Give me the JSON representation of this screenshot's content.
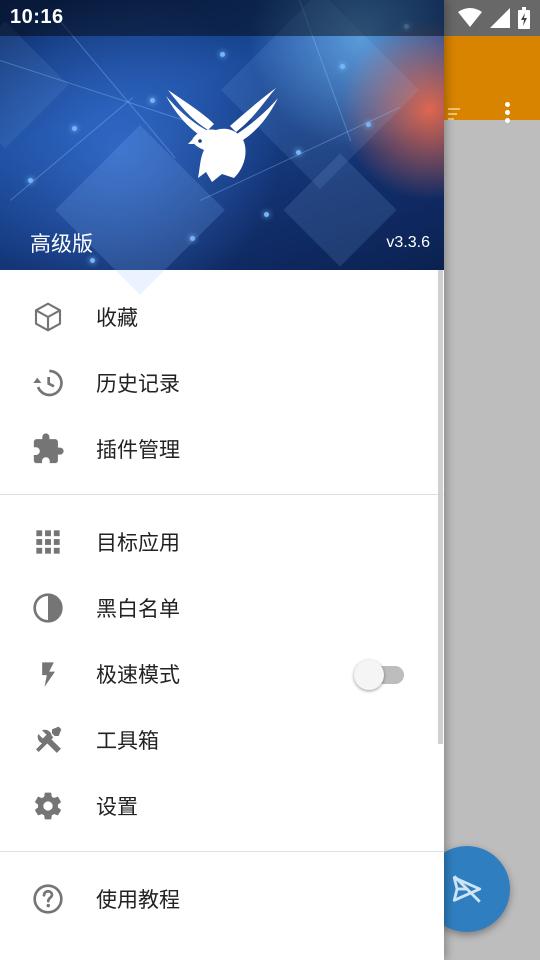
{
  "status_bar": {
    "time": "10:16"
  },
  "header": {
    "title": "高级版",
    "version": "v3.3.6"
  },
  "menu": {
    "group1": [
      {
        "label": "收藏",
        "icon": "box-icon"
      },
      {
        "label": "历史记录",
        "icon": "history-icon"
      },
      {
        "label": "插件管理",
        "icon": "puzzle-icon"
      }
    ],
    "group2": [
      {
        "label": "目标应用",
        "icon": "grid-icon"
      },
      {
        "label": "黑白名单",
        "icon": "half-circle-icon"
      },
      {
        "label": "极速模式",
        "icon": "bolt-icon",
        "toggle": false
      },
      {
        "label": "工具箱",
        "icon": "tools-icon"
      },
      {
        "label": "设置",
        "icon": "gear-icon"
      }
    ],
    "group3": [
      {
        "label": "使用教程",
        "icon": "help-icon"
      }
    ]
  },
  "colors": {
    "toolbar": "#d88400",
    "fab": "#2f7fc0",
    "icon": "#757575"
  }
}
